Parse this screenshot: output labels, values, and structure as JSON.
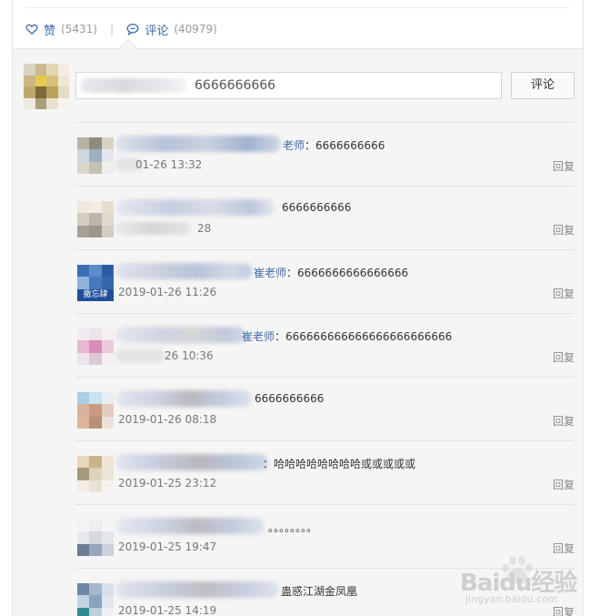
{
  "actions": {
    "like_label": "赞",
    "like_count": "(5431)",
    "separator": "|",
    "comment_label": "评论",
    "comment_count": "(40979)"
  },
  "composer": {
    "input_value": "6666666666",
    "submit_label": "评论"
  },
  "comments": [
    {
      "prefix": "老师",
      "text": "：6666666666",
      "time": "01-26 13:32",
      "reply": "回复"
    },
    {
      "prefix": "",
      "text": "6666666666",
      "time": "28",
      "reply": "回复"
    },
    {
      "prefix": "崔老师",
      "text": "：6666666666666666",
      "time": "2019-01-26 11:26",
      "reply": "回复"
    },
    {
      "prefix": "崔老师",
      "text": "：666666666666666666666666",
      "time": "26 10:36",
      "reply": "回复"
    },
    {
      "prefix": "",
      "text": "6666666666",
      "time": "2019-01-26 08:18",
      "reply": "回复"
    },
    {
      "prefix": "",
      "text": "：哈哈哈哈哈哈哈哈或或或或或",
      "time": "2019-01-25 23:12",
      "reply": "回复"
    },
    {
      "prefix": "",
      "text": "。。。。。。。。",
      "time": "2019-01-25 19:47",
      "reply": "回复"
    },
    {
      "prefix": "",
      "text": "蛊惑江湖金凤凰",
      "time": "2019-01-25 14:19",
      "reply": "回复"
    }
  ],
  "avatar_badge": "撒忘肆",
  "watermark": {
    "brand": "Baidu经验",
    "url": "jingyan.baidu.com"
  }
}
